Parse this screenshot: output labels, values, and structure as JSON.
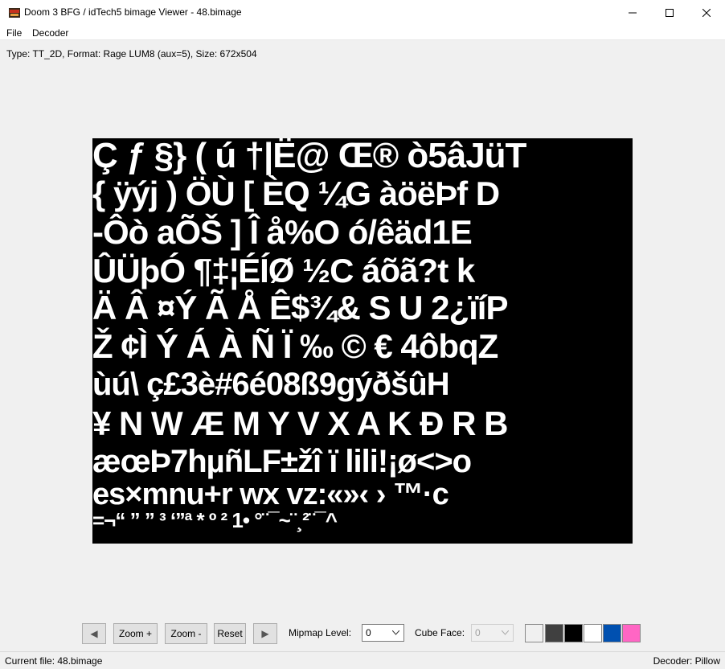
{
  "window": {
    "title": "Doom 3 BFG / idTech5 bimage Viewer - 48.bimage",
    "app_icon": "doom-app-icon"
  },
  "menu": {
    "items": [
      "File",
      "Decoder"
    ]
  },
  "info": {
    "text": "Type: TT_2D, Format: Rage LUM8 (aux=5), Size: 672x504"
  },
  "image": {
    "rows": [
      "Ç ƒ §} ( ú †|Ë@ Œ® ò5âJüT",
      "{ ÿýj ) ÖÙ [ ÈQ ¼G àöëÞf D",
      "-Ôò aÕŠ ] Î å%O ó/êäd1E",
      "ÛÜþÓ ¶‡¦ÉÍØ ½C áõã?t k",
      "Ä Â ¤Ý Ã Å Ê$¾& S U 2¿ïíP",
      "Ž ¢Ì Ý Á À Ñ Ï ‰ © € 4ôbqZ",
      "ùú\\  ç£3è#6é08ß9gýðšûH",
      "¥ N  W Æ M Y V X A K Đ R B",
      "æœÞ7hµñLF±žî ï lili!¡ø<>o",
      "es×mnu+r wx vz:«»‹ › ™·c",
      "=¬“ ” ” ³ ‘’’ª * º ² 1• °¨¯~¨¸²¨¯^"
    ]
  },
  "toolbar": {
    "prev_label": "◀",
    "zoom_in_label": "Zoom +",
    "zoom_out_label": "Zoom -",
    "reset_label": "Reset",
    "next_label": "▶",
    "mipmap_label": "Mipmap Level:",
    "mipmap_value": "0",
    "cube_label": "Cube Face:",
    "cube_value": "0",
    "swatch_colors": [
      "#f0f0f0",
      "#404040",
      "#000000",
      "#ffffff",
      "#0050b0",
      "#ff66c4"
    ]
  },
  "status": {
    "current_file": "Current file: 48.bimage",
    "decoder": "Decoder: Pillow"
  }
}
